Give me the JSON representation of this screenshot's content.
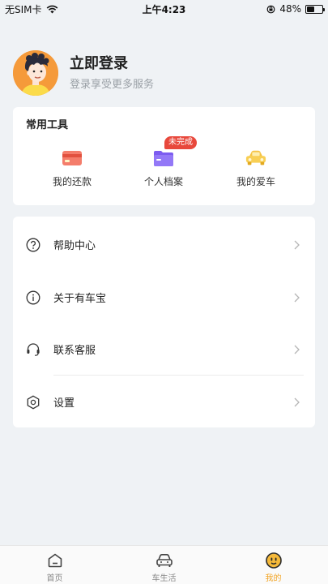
{
  "status_bar": {
    "carrier": "无SIM卡",
    "time": "上午4:23",
    "battery_text": "48%",
    "battery_level": 0.48
  },
  "profile": {
    "title": "立即登录",
    "subtitle": "登录享受更多服务"
  },
  "tools": {
    "title": "常用工具",
    "items": [
      {
        "label": "我的还款",
        "icon": "card-icon",
        "color": "#e8564b"
      },
      {
        "label": "个人档案",
        "icon": "folder-icon",
        "color": "#7c5cf0",
        "badge": "未完成"
      },
      {
        "label": "我的爱车",
        "icon": "car-icon",
        "color": "#f5c343"
      }
    ]
  },
  "menu": {
    "items": [
      {
        "label": "帮助中心",
        "icon": "question-icon"
      },
      {
        "label": "关于有车宝",
        "icon": "info-icon"
      },
      {
        "label": "联系客服",
        "icon": "headset-icon"
      },
      {
        "label": "设置",
        "icon": "settings-icon"
      }
    ]
  },
  "tab_bar": {
    "tabs": [
      {
        "label": "首页",
        "icon": "home-icon"
      },
      {
        "label": "车生活",
        "icon": "car-outline-icon"
      },
      {
        "label": "我的",
        "icon": "smiley-icon",
        "active": true
      }
    ]
  },
  "colors": {
    "background": "#eff2f5",
    "accent": "#f2a526",
    "badge": "#e8483c"
  }
}
